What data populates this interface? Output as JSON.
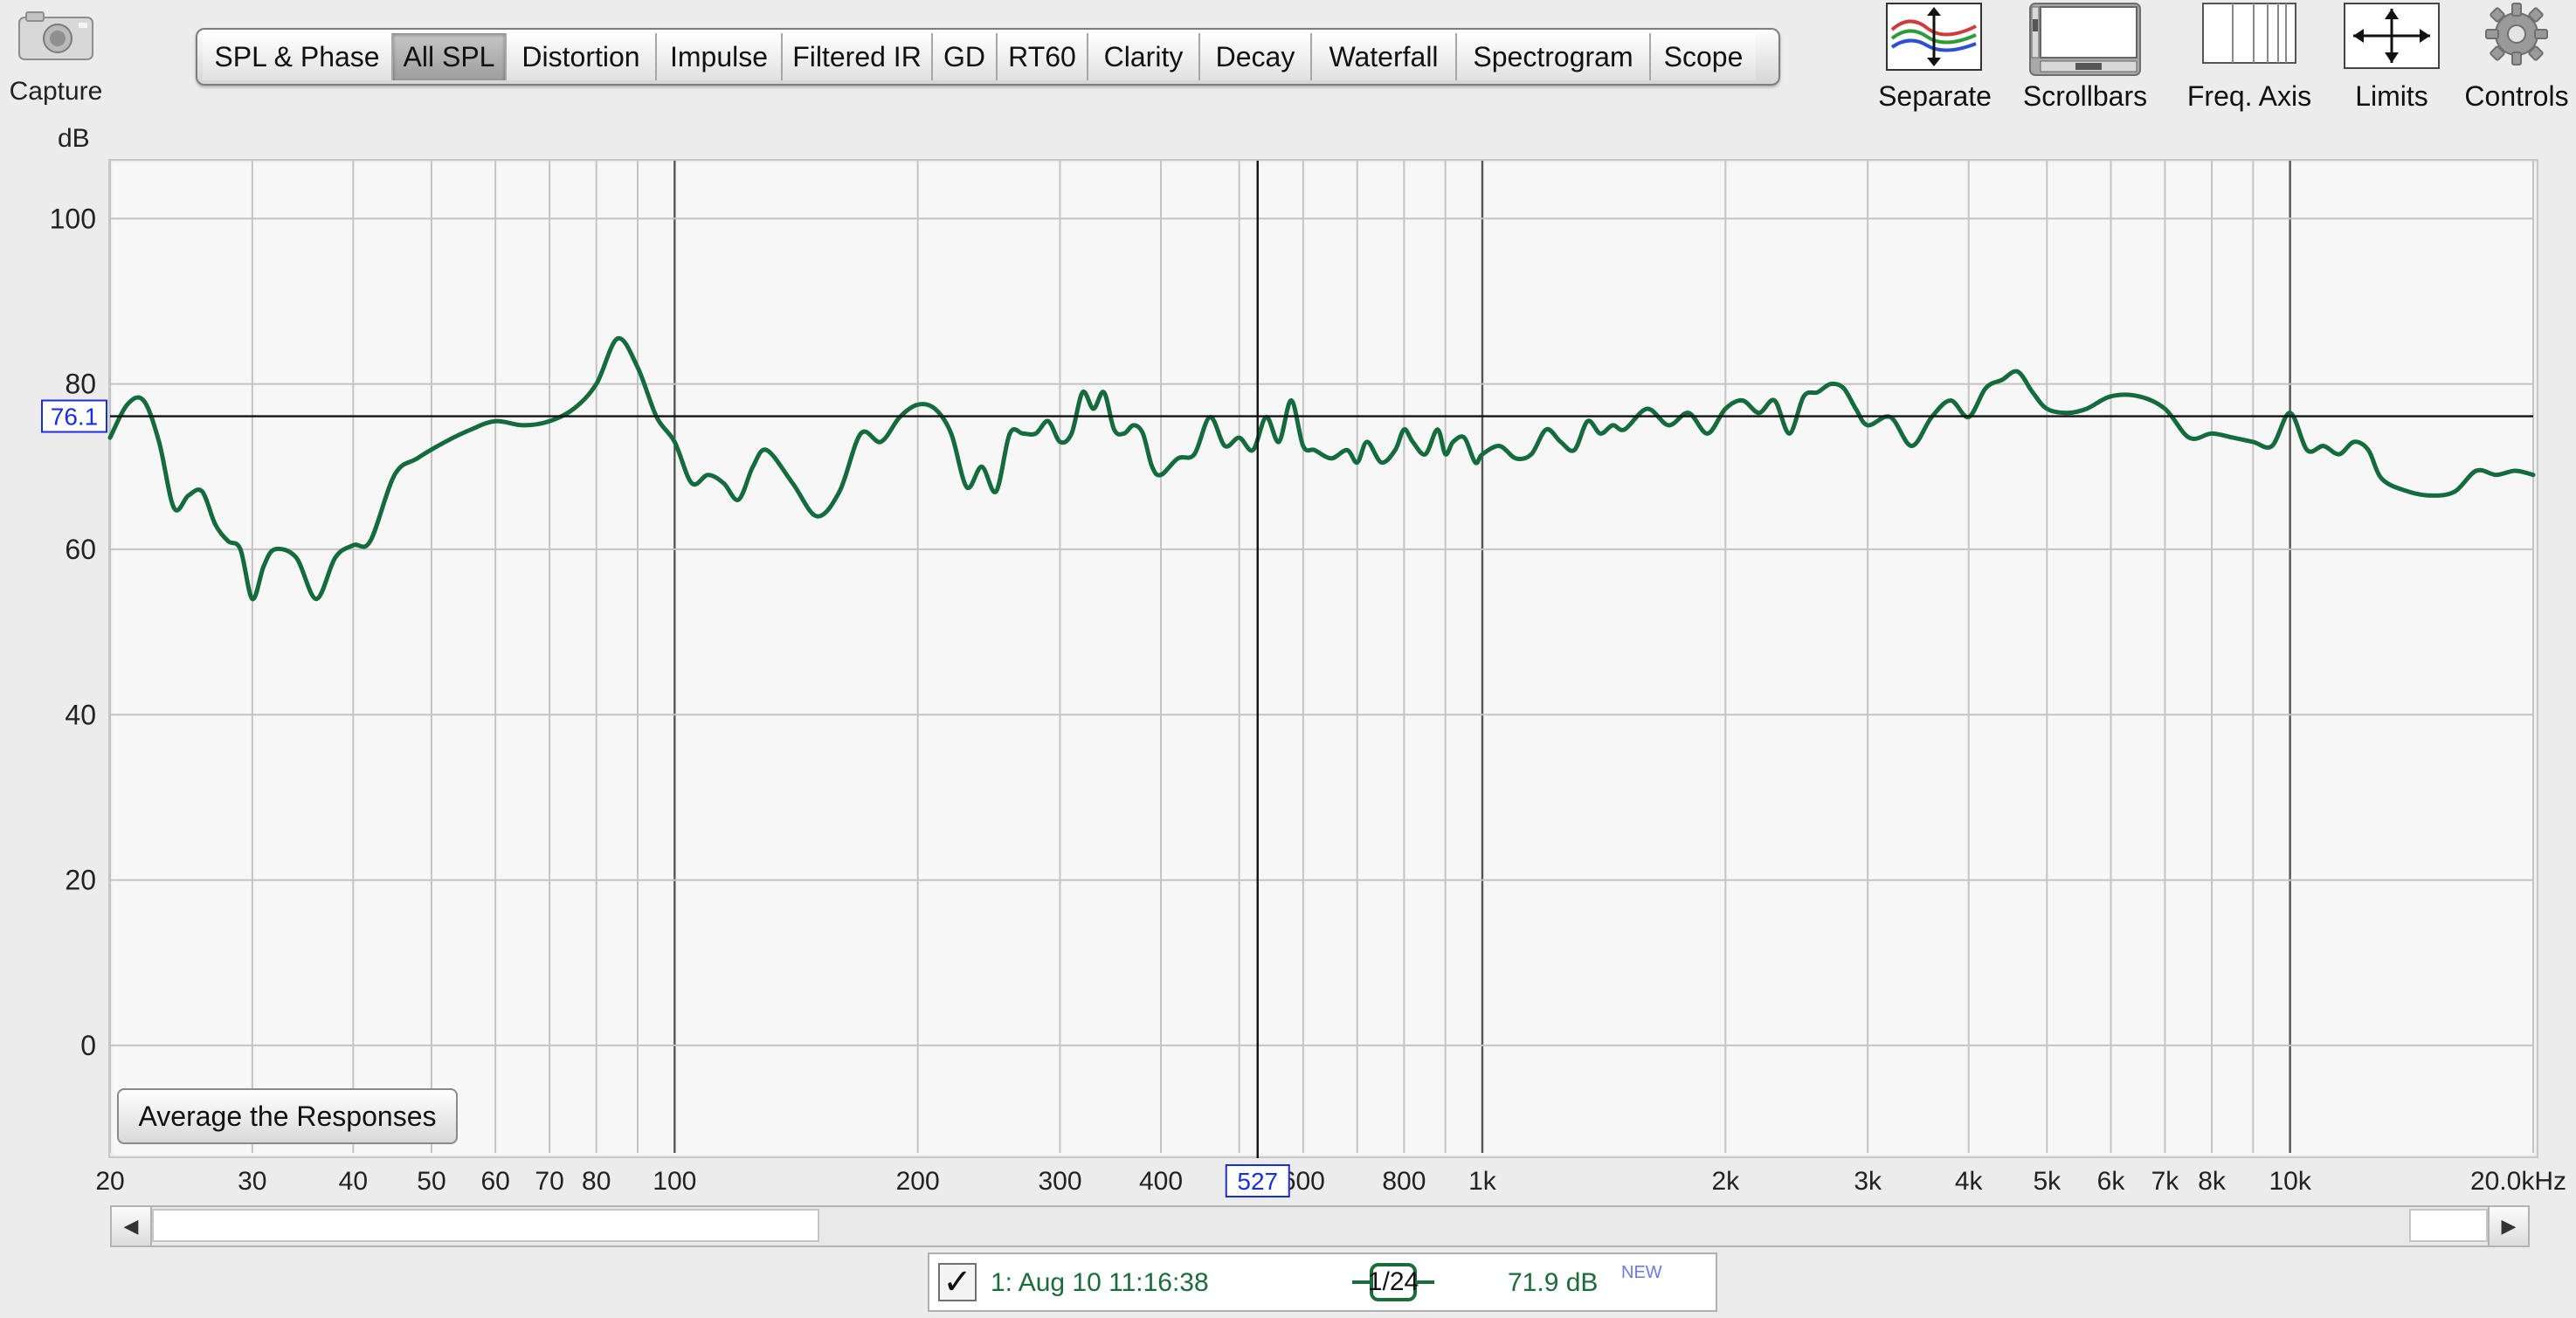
{
  "capture": {
    "label": "Capture"
  },
  "tabs": [
    {
      "label": "SPL & Phase",
      "active": false
    },
    {
      "label": "All SPL",
      "active": true
    },
    {
      "label": "Distortion",
      "active": false
    },
    {
      "label": "Impulse",
      "active": false
    },
    {
      "label": "Filtered IR",
      "active": false
    },
    {
      "label": "GD",
      "active": false
    },
    {
      "label": "RT60",
      "active": false
    },
    {
      "label": "Clarity",
      "active": false
    },
    {
      "label": "Decay",
      "active": false
    },
    {
      "label": "Waterfall",
      "active": false
    },
    {
      "label": "Spectrogram",
      "active": false
    },
    {
      "label": "Scope",
      "active": false
    }
  ],
  "tools": {
    "separate": "Separate",
    "scrollbars": "Scrollbars",
    "freq_axis": "Freq. Axis",
    "limits": "Limits",
    "controls": "Controls"
  },
  "graph": {
    "y_unit": "dB",
    "avg_button": "Average the Responses",
    "cursor_y_readout": "76.1",
    "cursor_x_readout": "527"
  },
  "legend": {
    "checked": true,
    "name": "1: Aug 10 11:16:38",
    "smoothing": "1/24",
    "value": "71.9 dB",
    "badge": "NEW"
  },
  "chart_data": {
    "type": "line",
    "xscale": "log",
    "ylabel": "dB",
    "xlim": [
      20,
      20000
    ],
    "ylim": [
      -13,
      107
    ],
    "y_ticks": [
      0,
      20,
      40,
      60,
      80,
      100
    ],
    "x_ticks": [
      {
        "value": 20,
        "label": "20"
      },
      {
        "value": 30,
        "label": "30"
      },
      {
        "value": 40,
        "label": "40"
      },
      {
        "value": 50,
        "label": "50"
      },
      {
        "value": 60,
        "label": "60"
      },
      {
        "value": 70,
        "label": "70"
      },
      {
        "value": 80,
        "label": "80"
      },
      {
        "value": 100,
        "label": "100"
      },
      {
        "value": 200,
        "label": "200"
      },
      {
        "value": 300,
        "label": "300"
      },
      {
        "value": 400,
        "label": "400"
      },
      {
        "value": 500,
        "label": "5"
      },
      {
        "value": 600,
        "label": "600"
      },
      {
        "value": 800,
        "label": "800"
      },
      {
        "value": 1000,
        "label": "1k"
      },
      {
        "value": 2000,
        "label": "2k"
      },
      {
        "value": 3000,
        "label": "3k"
      },
      {
        "value": 4000,
        "label": "4k"
      },
      {
        "value": 5000,
        "label": "5k"
      },
      {
        "value": 6000,
        "label": "6k"
      },
      {
        "value": 7000,
        "label": "7k"
      },
      {
        "value": 8000,
        "label": "8k"
      },
      {
        "value": 10000,
        "label": "10k"
      },
      {
        "value": 20000,
        "label": "20.0kHz"
      }
    ],
    "grid": true,
    "cursor": {
      "x": 527,
      "y": 76.1
    },
    "line_color": "#146b3c",
    "series": [
      {
        "x": [
          20,
          21,
          22,
          23,
          24,
          25,
          26,
          27,
          28,
          29,
          30,
          31,
          32,
          34,
          36,
          38,
          40,
          42,
          45,
          48,
          52,
          56,
          60,
          65,
          70,
          75,
          80,
          85,
          90,
          95,
          100,
          105,
          110,
          115,
          120,
          125,
          130,
          140,
          150,
          160,
          170,
          180,
          190,
          200,
          210,
          220,
          230,
          240,
          250,
          260,
          270,
          280,
          290,
          300,
          310,
          320,
          330,
          340,
          350,
          360,
          370,
          380,
          390,
          400,
          420,
          440,
          460,
          480,
          500,
          520,
          540,
          560,
          580,
          600,
          620,
          650,
          680,
          700,
          720,
          750,
          780,
          800,
          820,
          850,
          880,
          900,
          920,
          950,
          980,
          1000,
          1050,
          1100,
          1150,
          1200,
          1250,
          1300,
          1350,
          1400,
          1450,
          1500,
          1600,
          1700,
          1800,
          1900,
          2000,
          2100,
          2200,
          2300,
          2400,
          2500,
          2600,
          2700,
          2800,
          2900,
          3000,
          3200,
          3400,
          3600,
          3800,
          4000,
          4200,
          4400,
          4600,
          4800,
          5000,
          5300,
          5600,
          6000,
          6500,
          7000,
          7500,
          8000,
          8500,
          9000,
          9500,
          10000,
          10500,
          11000,
          11500,
          12000,
          12500,
          13000,
          14000,
          15000,
          16000,
          17000,
          18000,
          19000,
          20000
        ],
        "y": [
          73.5,
          77.5,
          78,
          73,
          65,
          66.5,
          67,
          63,
          61,
          60,
          54,
          58,
          60,
          59,
          54,
          59,
          60.5,
          61,
          69,
          71,
          73,
          74.5,
          75.5,
          75,
          75.5,
          77,
          80,
          85.5,
          82,
          76,
          73,
          68,
          69,
          68,
          66,
          70,
          72,
          68,
          64,
          67,
          74,
          73,
          76,
          77.5,
          77,
          74,
          67.5,
          70,
          67,
          74,
          74,
          74,
          75.5,
          73,
          74,
          79,
          77,
          79,
          74.5,
          74,
          75,
          74,
          70,
          69,
          71,
          71.5,
          76,
          72.5,
          73.5,
          72,
          76,
          73,
          78,
          72.5,
          72,
          71,
          72,
          70.5,
          73,
          70.5,
          72,
          74.5,
          73,
          71.5,
          74.5,
          71.5,
          73,
          73.5,
          70.5,
          71.5,
          72.5,
          71,
          71.5,
          74.5,
          73,
          72,
          75.5,
          74,
          75,
          74.5,
          77,
          75,
          76.5,
          74,
          77,
          78,
          76.5,
          78,
          74,
          78.5,
          79,
          80,
          79.5,
          77,
          75,
          76,
          72.5,
          76,
          78,
          76,
          79.5,
          80.5,
          81.5,
          79,
          77,
          76.5,
          77,
          78.5,
          78.5,
          77,
          73.5,
          74,
          73.5,
          73,
          72.5,
          76.5,
          72,
          72.5,
          71.5,
          73,
          72,
          68.5,
          67,
          66.5,
          67,
          69.5,
          69,
          69.5,
          69
        ]
      }
    ]
  }
}
